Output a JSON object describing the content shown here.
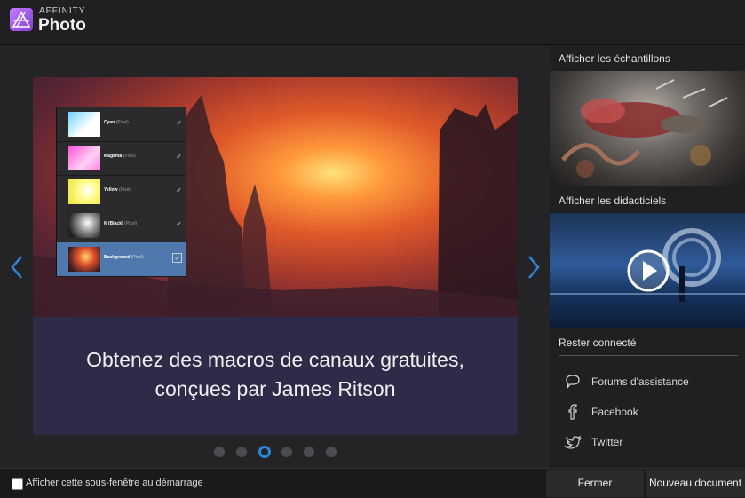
{
  "app": {
    "brand_top": "AFFINITY",
    "brand_name": "Photo"
  },
  "carousel": {
    "caption_line1": "Obtenez des macros de canaux gratuites,",
    "caption_line2": "conçues par James Ritson",
    "dot_count": 6,
    "active_dot_index": 2,
    "layers": [
      {
        "name": "Cyan",
        "kind": "(Pixel)",
        "checked": "✓"
      },
      {
        "name": "Magenta",
        "kind": "(Pixel)",
        "checked": "✓"
      },
      {
        "name": "Yellow",
        "kind": "(Pixel)",
        "checked": "✓"
      },
      {
        "name": "K (Black)",
        "kind": "(Pixel)",
        "checked": "✓"
      },
      {
        "name": "Background",
        "kind": "(Pixel)",
        "checked": "✓"
      }
    ]
  },
  "sidebar": {
    "samples_title": "Afficher les échantillons",
    "tutorials_title": "Afficher les didacticiels",
    "connect_title": "Rester connecté",
    "links": [
      {
        "label": "Forums d'assistance",
        "icon": "chat-bubble-icon"
      },
      {
        "label": "Facebook",
        "icon": "facebook-icon"
      },
      {
        "label": "Twitter",
        "icon": "twitter-icon"
      }
    ]
  },
  "footer": {
    "startup_checkbox_label": "Afficher cette sous-fenêtre au démarrage",
    "close_label": "Fermer",
    "new_document_label": "Nouveau document"
  },
  "colors": {
    "accent": "#2c86d6",
    "caption_bg": "#2d2b48",
    "logo": "#b36cf5"
  }
}
